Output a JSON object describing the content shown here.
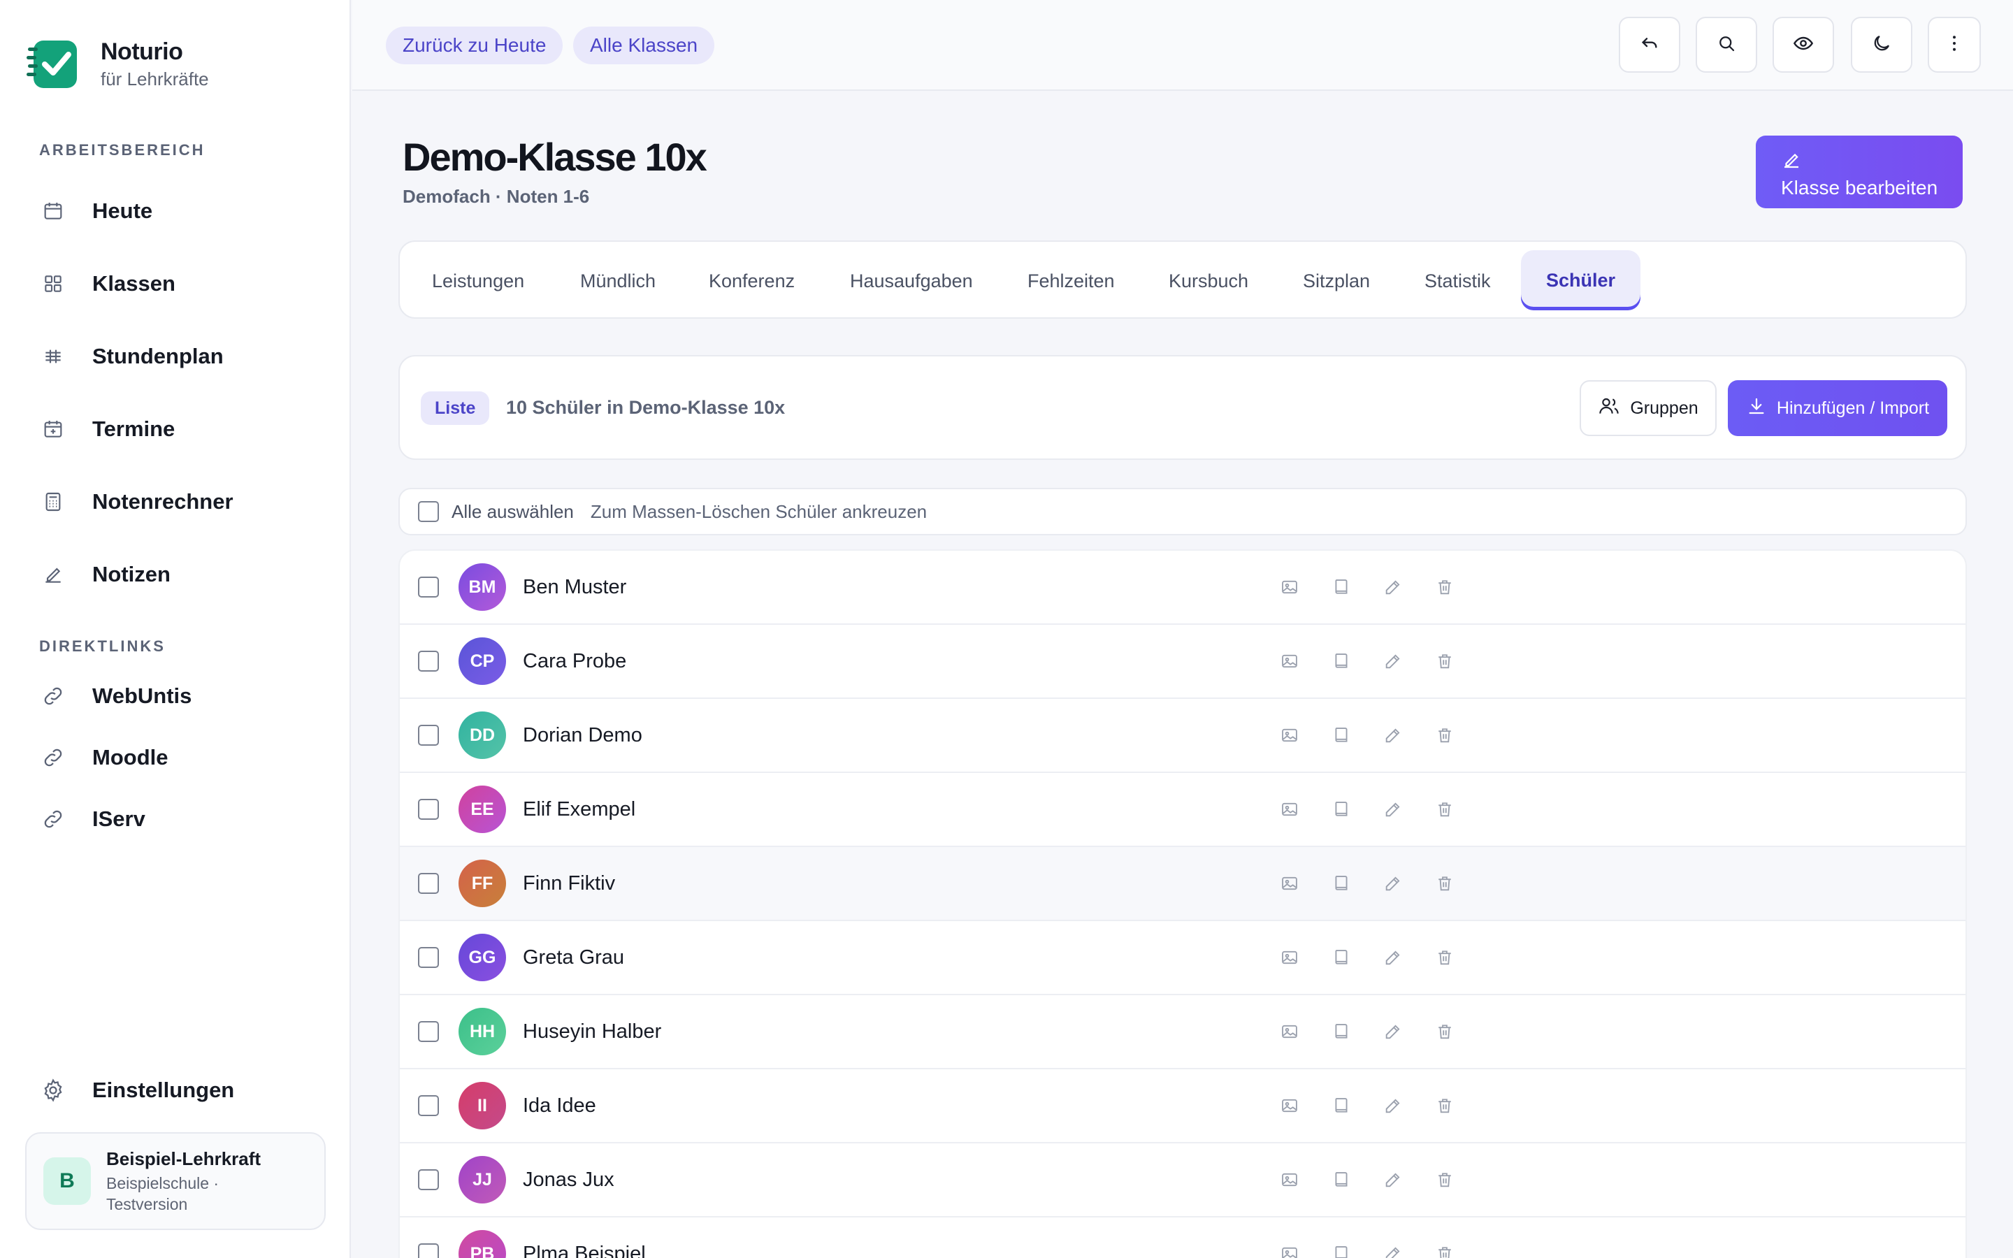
{
  "brand": {
    "name": "Noturio",
    "subtitle": "für Lehrkräfte",
    "accent": "#13a27a"
  },
  "sidebar": {
    "workspace_label": "ARBEITSBEREICH",
    "items": [
      {
        "label": "Heute",
        "icon": "calendar-icon"
      },
      {
        "label": "Klassen",
        "icon": "grid-icon"
      },
      {
        "label": "Stundenplan",
        "icon": "timetable-icon"
      },
      {
        "label": "Termine",
        "icon": "calendar-plus-icon"
      },
      {
        "label": "Notenrechner",
        "icon": "calculator-icon"
      },
      {
        "label": "Notizen",
        "icon": "pencil-icon"
      }
    ],
    "links_label": "DIREKTLINKS",
    "links": [
      {
        "label": "WebUntis",
        "icon": "link-icon"
      },
      {
        "label": "Moodle",
        "icon": "link-icon"
      },
      {
        "label": "IServ",
        "icon": "link-icon"
      }
    ],
    "settings_label": "Einstellungen"
  },
  "user": {
    "initial": "B",
    "name": "Beispiel-Lehrkraft",
    "meta": "Beispielschule · Testversion"
  },
  "topbar": {
    "back_today": "Zurück zu Heute",
    "all_classes": "Alle Klassen",
    "icons": [
      "undo-icon",
      "search-icon",
      "eye-icon",
      "moon-icon",
      "more-vertical-icon"
    ]
  },
  "header": {
    "title": "Demo-Klasse 10x",
    "subtitle": "Demofach · Noten 1-6",
    "edit_button": "Klasse bearbeiten"
  },
  "tabs": [
    {
      "label": "Leistungen"
    },
    {
      "label": "Mündlich"
    },
    {
      "label": "Konferenz"
    },
    {
      "label": "Hausaufgaben"
    },
    {
      "label": "Fehlzeiten"
    },
    {
      "label": "Kursbuch"
    },
    {
      "label": "Sitzplan"
    },
    {
      "label": "Statistik"
    },
    {
      "label": "Schüler",
      "active": true
    }
  ],
  "toolbar": {
    "view_badge": "Liste",
    "count_text": "10 Schüler in Demo-Klasse 10x",
    "groups_button": "Gruppen",
    "import_button": "Hinzufügen / Import"
  },
  "select_all": {
    "label": "Alle auswählen",
    "hint": "Zum Massen-Löschen Schüler ankreuzen"
  },
  "students": [
    {
      "initials": "BM",
      "name": "Ben Muster",
      "color_from": "#7a4ce0",
      "color_to": "#b35ad9"
    },
    {
      "initials": "CP",
      "name": "Cara Probe",
      "color_from": "#5a55d8",
      "color_to": "#7a5ce6"
    },
    {
      "initials": "DD",
      "name": "Dorian Demo",
      "color_from": "#31b3a0",
      "color_to": "#54c3a8"
    },
    {
      "initials": "EE",
      "name": "Elif Exempel",
      "color_from": "#d0429e",
      "color_to": "#b854d4"
    },
    {
      "initials": "FF",
      "name": "Finn Fiktiv",
      "color_from": "#d4624a",
      "color_to": "#c8803a"
    },
    {
      "initials": "GG",
      "name": "Greta Grau",
      "color_from": "#6648d9",
      "color_to": "#8a4fe0"
    },
    {
      "initials": "HH",
      "name": "Huseyin Halber",
      "color_from": "#3cc08a",
      "color_to": "#5bd09a"
    },
    {
      "initials": "II",
      "name": "Ida Idee",
      "color_from": "#d53d6a",
      "color_to": "#c44a8a"
    },
    {
      "initials": "JJ",
      "name": "Jonas Jux",
      "color_from": "#a044c8",
      "color_to": "#c15ab8"
    },
    {
      "initials": "PB",
      "name": "Plma Beispiel",
      "color_from": "#d04aa0",
      "color_to": "#b84ac8"
    }
  ],
  "row_actions": [
    "image-icon",
    "book-icon",
    "edit-icon",
    "trash-icon"
  ]
}
